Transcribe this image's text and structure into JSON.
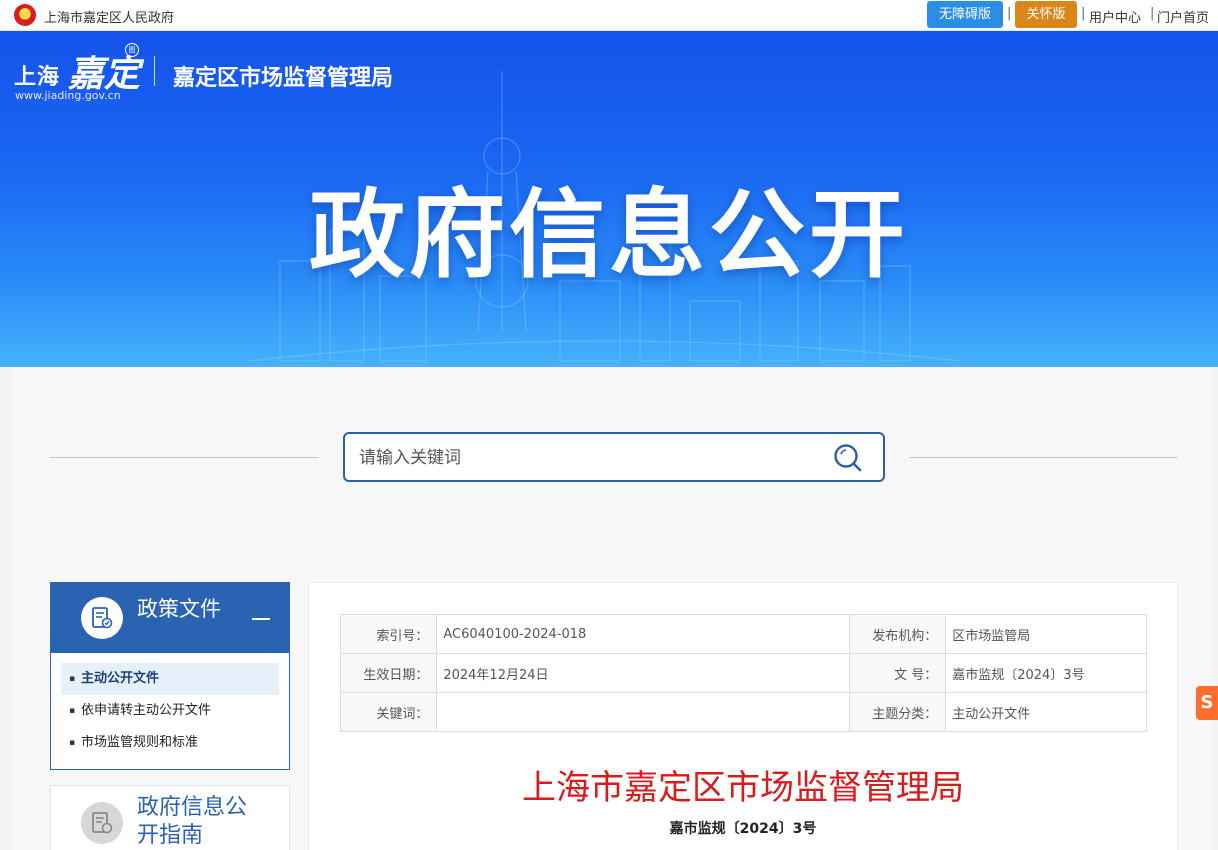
{
  "topbar": {
    "gov_name": "上海市嘉定区人民政府",
    "accessibility_label": "无障碍版",
    "care_label": "关怀版",
    "separator": "|",
    "user_center": "用户中心",
    "portal_home": "门户首页"
  },
  "header": {
    "logo_shanghai": "上海",
    "logo_jiading": "嘉定",
    "logo_badge": "图",
    "logo_url": "www.jiading.gov.cn",
    "dept_name": "嘉定区市场监督管理局",
    "banner_title": "政府信息公开"
  },
  "search": {
    "placeholder": "请输入关键词"
  },
  "sidebar": {
    "section_title": "政策文件",
    "items": [
      {
        "label": "主动公开文件"
      },
      {
        "label": "依申请转主动公开文件"
      },
      {
        "label": "市场监管规则和标准"
      }
    ],
    "guide_title": "政府信息公开指南"
  },
  "document": {
    "meta": {
      "index_label": "索引号：",
      "index_value": "AC6040100-2024-018",
      "publisher_label": "发布机构：",
      "publisher_value": "区市场监管局",
      "effective_label": "生效日期：",
      "effective_value": "2024年12月24日",
      "docno_label": "文 号：",
      "docno_value": "嘉市监规〔2024〕3号",
      "keywords_label": "关键词：",
      "keywords_value": "",
      "topic_label": "主题分类：",
      "topic_value": "主动公开文件"
    },
    "issuer": "上海市嘉定区市场监督管理局",
    "number": "嘉市监规〔2024〕3号"
  },
  "float_tab": {
    "glyph": "S"
  },
  "colors": {
    "primary_blue": "#2a63b2",
    "accessibility_blue": "#2b8ee6",
    "care_orange": "#d9871a",
    "doc_red": "#d81b1b"
  }
}
